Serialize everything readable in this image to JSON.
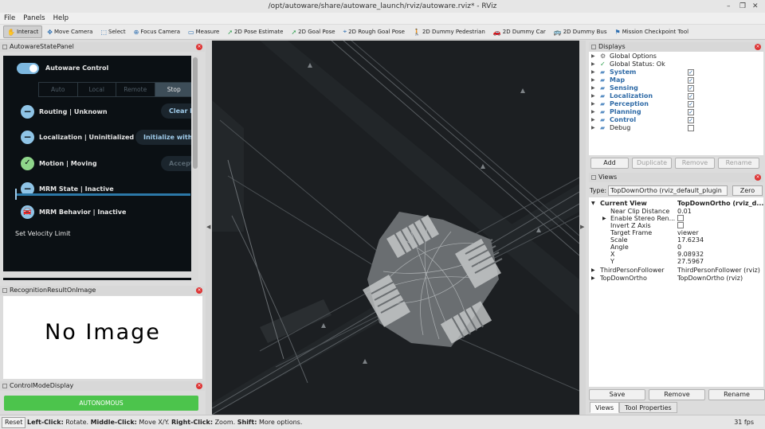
{
  "window": {
    "title": "/opt/autoware/share/autoware_launch/rviz/autoware.rviz* - RViz",
    "controls": [
      "–",
      "❐",
      "✕"
    ]
  },
  "menu": [
    "File",
    "Panels",
    "Help"
  ],
  "toolbar": [
    {
      "label": "Interact",
      "icon": "hand-icon",
      "glyph": "✋",
      "active": true
    },
    {
      "label": "Move Camera",
      "icon": "move-camera-icon",
      "glyph": "✥"
    },
    {
      "label": "Select",
      "icon": "select-icon",
      "glyph": "⬚"
    },
    {
      "label": "Focus Camera",
      "icon": "focus-camera-icon",
      "glyph": "⊕"
    },
    {
      "label": "Measure",
      "icon": "measure-icon",
      "glyph": "▭"
    },
    {
      "label": "2D Pose Estimate",
      "icon": "pose-estimate-icon",
      "glyph": "➚"
    },
    {
      "label": "2D Goal Pose",
      "icon": "goal-pose-icon",
      "glyph": "➚"
    },
    {
      "label": "2D Rough Goal Pose",
      "icon": "rough-goal-icon",
      "glyph": "⌖"
    },
    {
      "label": "2D Dummy Pedestrian",
      "icon": "pedestrian-icon",
      "glyph": "🚶"
    },
    {
      "label": "2D Dummy Car",
      "icon": "car-icon",
      "glyph": "🚗"
    },
    {
      "label": "2D Dummy Bus",
      "icon": "bus-icon",
      "glyph": "🚌"
    },
    {
      "label": "Mission Checkpoint Tool",
      "icon": "checkpoint-icon",
      "glyph": "⚑"
    }
  ],
  "state_panel": {
    "title": "AutowareStatePanel",
    "control_label": "Autoware Control",
    "modes": [
      "Auto",
      "Local",
      "Remote",
      "Stop"
    ],
    "selected_mode": "Stop",
    "rows": [
      {
        "label": "Routing | Unknown",
        "button": "Clear R"
      },
      {
        "label": "Localization | Uninitialized",
        "button": "Initialize with"
      },
      {
        "label": "Motion | Moving",
        "button": "Accept"
      },
      {
        "label": "MRM State | Inactive"
      },
      {
        "label": "MRM Behavior | Inactive"
      }
    ],
    "velocity_label": "Set Velocity Limit"
  },
  "recognition_panel": {
    "title": "RecognitionResultOnImage",
    "placeholder": "No Image"
  },
  "control_mode_panel": {
    "title": "ControlModeDisplay",
    "status": "AUTONOMOUS"
  },
  "displays": {
    "title": "Displays",
    "items": [
      {
        "label": "Global Options",
        "icon": "gear-icon",
        "glyph": "⚙",
        "bold": false
      },
      {
        "label": "Global Status: Ok",
        "icon": "check-icon",
        "glyph": "✓",
        "bold": false
      },
      {
        "label": "System",
        "icon": "folder-icon",
        "glyph": "▰",
        "bold": true,
        "checked": true
      },
      {
        "label": "Map",
        "icon": "folder-icon",
        "glyph": "▰",
        "bold": true,
        "checked": true
      },
      {
        "label": "Sensing",
        "icon": "folder-icon",
        "glyph": "▰",
        "bold": true,
        "checked": true
      },
      {
        "label": "Localization",
        "icon": "folder-icon",
        "glyph": "▰",
        "bold": true,
        "checked": true
      },
      {
        "label": "Perception",
        "icon": "folder-icon",
        "glyph": "▰",
        "bold": true,
        "checked": true
      },
      {
        "label": "Planning",
        "icon": "folder-icon",
        "glyph": "▰",
        "bold": true,
        "checked": true
      },
      {
        "label": "Control",
        "icon": "folder-icon",
        "glyph": "▰",
        "bold": true,
        "checked": true
      },
      {
        "label": "Debug",
        "icon": "folder-icon",
        "glyph": "▰",
        "bold": false,
        "checked": false
      }
    ],
    "buttons": [
      "Add",
      "Duplicate",
      "Remove",
      "Rename"
    ]
  },
  "views": {
    "title": "Views",
    "type_label": "Type:",
    "type_value": "TopDownOrtho (rviz_default_plugin",
    "zero_label": "Zero",
    "current_view": {
      "key": "Current View",
      "value": "TopDownOrtho (rviz_d..."
    },
    "props": [
      {
        "key": "Near Clip Distance",
        "value": "0.01"
      },
      {
        "key": "Enable Stereo Ren...",
        "value": ""
      },
      {
        "key": "Invert Z Axis",
        "value": ""
      },
      {
        "key": "Target Frame",
        "value": "viewer"
      },
      {
        "key": "Scale",
        "value": "17.6234"
      },
      {
        "key": "Angle",
        "value": "0"
      },
      {
        "key": "X",
        "value": "9.08932"
      },
      {
        "key": "Y",
        "value": "27.5967"
      }
    ],
    "saved": [
      {
        "key": "ThirdPersonFollower",
        "value": "ThirdPersonFollower (rviz)"
      },
      {
        "key": "TopDownOrtho",
        "value": "TopDownOrtho (rviz)"
      }
    ],
    "buttons": [
      "Save",
      "Remove",
      "Rename"
    ]
  },
  "tabs": [
    "Views",
    "Tool Properties"
  ],
  "statusbar": {
    "reset": "Reset",
    "hint_1b": "Left-Click:",
    "hint_1": " Rotate. ",
    "hint_2b": "Middle-Click:",
    "hint_2": " Move X/Y. ",
    "hint_3b": "Right-Click:",
    "hint_3": " Zoom. ",
    "hint_4b": "Shift:",
    "hint_4": " More options.",
    "fps": "31 fps"
  }
}
